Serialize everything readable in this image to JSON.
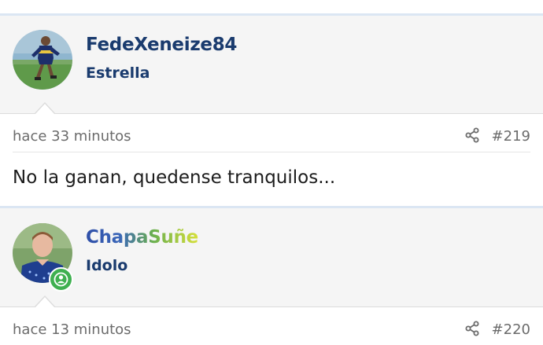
{
  "posts": [
    {
      "username": "FedeXeneize84",
      "username_color": "#1a3b6e",
      "user_title": "Estrella",
      "timestamp": "hace 33 minutos",
      "post_number": "#219",
      "message": "No la ganan, quedense tranquilos...",
      "share_icon": "share-icon"
    },
    {
      "username": "ChapaSuñe",
      "username_colors": [
        "#2f4fa8",
        "#6bb04f",
        "#d7e03a"
      ],
      "user_title": "Idolo",
      "timestamp": "hace 13 minutos",
      "post_number": "#220",
      "share_icon": "share-icon",
      "status_icon": "user-online-icon"
    }
  ],
  "colors": {
    "separator": "#dbe6f3",
    "user_block_bg": "#f5f5f5",
    "status_green": "#3fb050"
  }
}
